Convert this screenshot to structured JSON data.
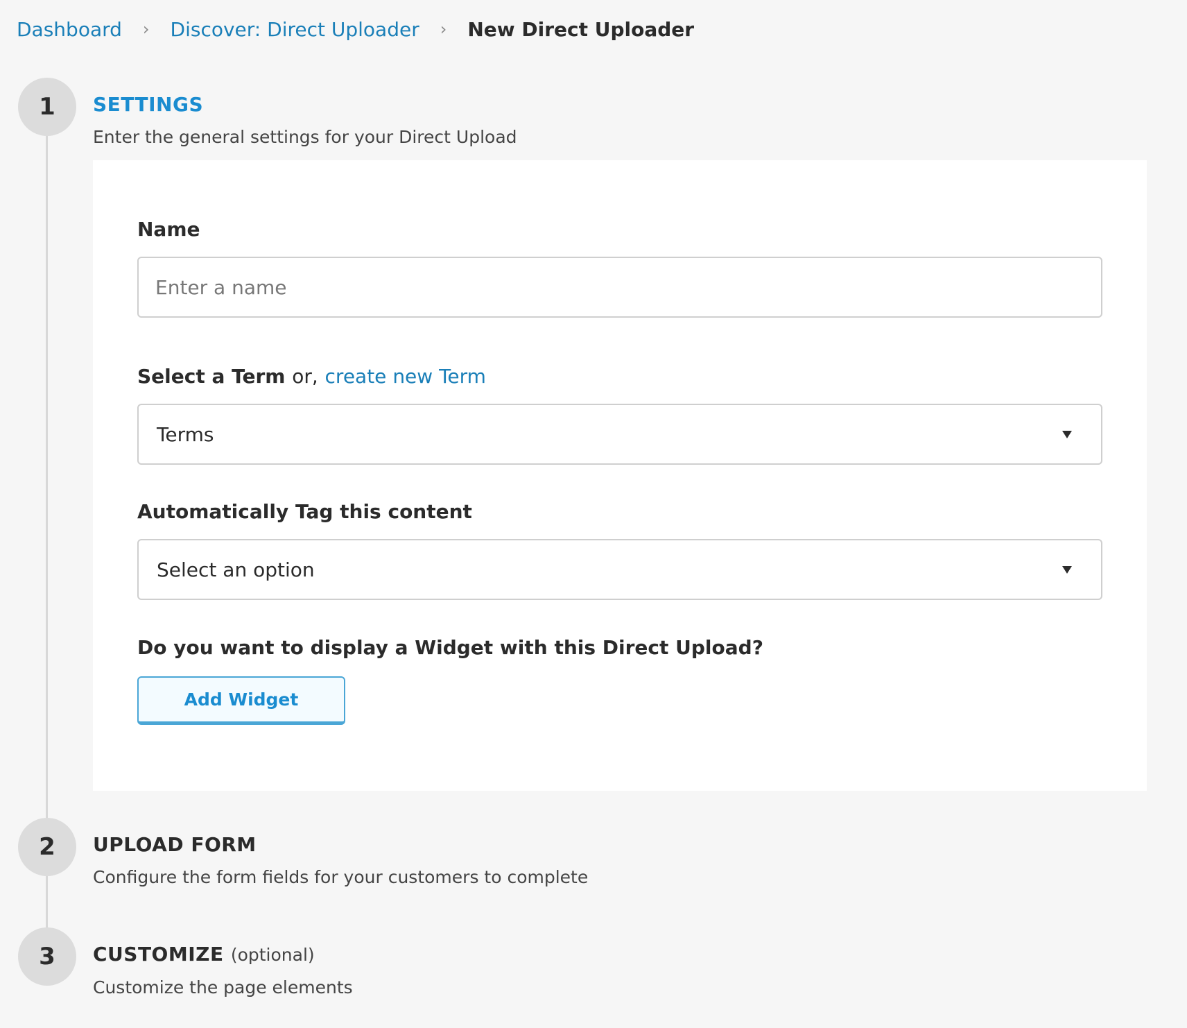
{
  "breadcrumb": {
    "items": [
      "Dashboard",
      "Discover: Direct Uploader"
    ],
    "separator": "›",
    "current": "New Direct Uploader"
  },
  "steps": [
    {
      "number": "1",
      "title": "SETTINGS",
      "description": "Enter the general settings for your Direct Upload"
    },
    {
      "number": "2",
      "title": "UPLOAD FORM",
      "description": "Configure the form fields for your customers to complete"
    },
    {
      "number": "3",
      "title": "CUSTOMIZE",
      "optional": "(optional)",
      "description": "Customize the page elements"
    }
  ],
  "settings_form": {
    "name_label": "Name",
    "name_placeholder": "Enter a name",
    "name_value": "",
    "term_label": "Select a Term",
    "term_or": "or,",
    "term_create_link": "create new Term",
    "term_selected": "Terms",
    "tag_label": "Automatically Tag this content",
    "tag_selected": "Select an option",
    "widget_question": "Do you want to display a Widget with this Direct Upload?",
    "add_widget_label": "Add Widget"
  },
  "colors": {
    "accent": "#1a8cd0",
    "link": "#1a7fb8",
    "background": "#f6f6f6",
    "panel": "#ffffff",
    "step_circle": "#dcdcdc"
  },
  "icons": {
    "breadcrumb_separator": "chevron-right-icon",
    "select_caret": "caret-down-icon"
  }
}
